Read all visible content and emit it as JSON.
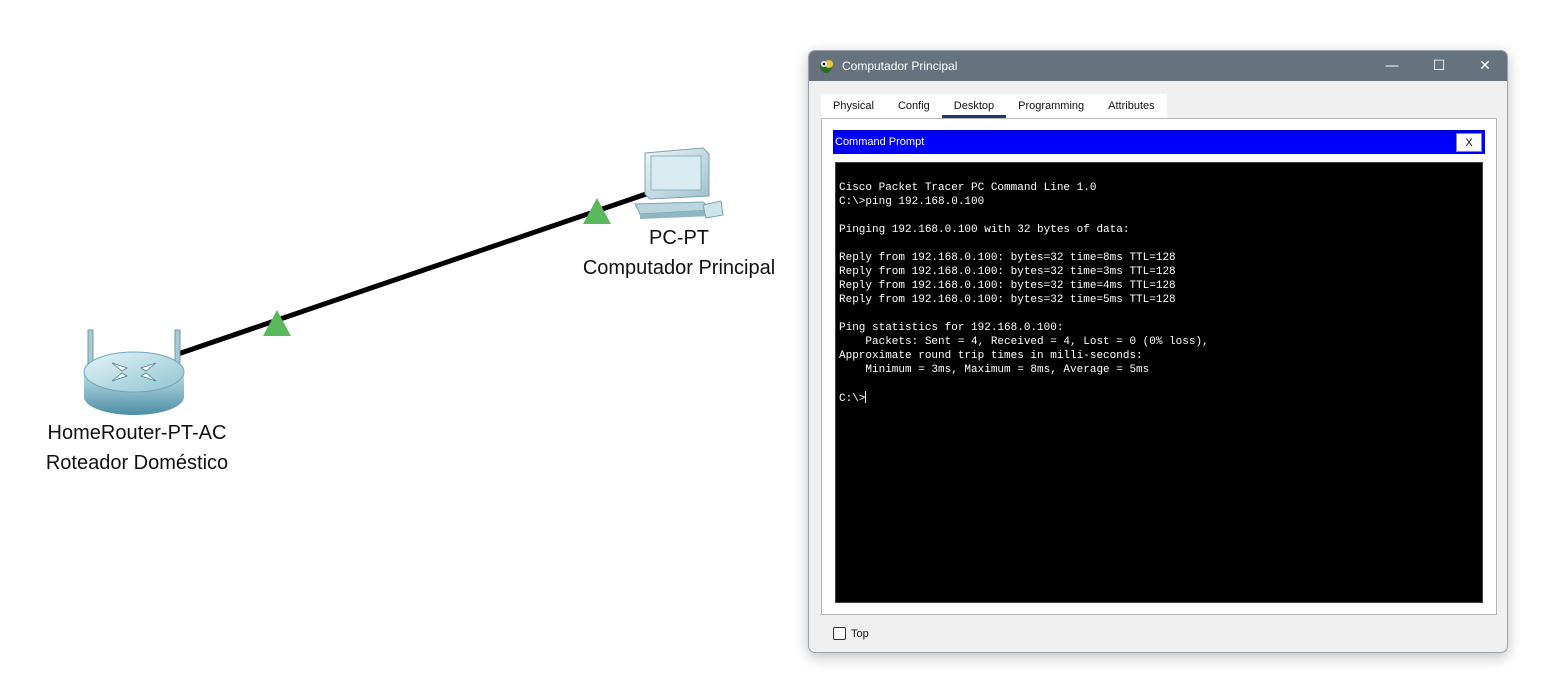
{
  "topology": {
    "router": {
      "model": "HomeRouter-PT-AC",
      "name": "Roteador Doméstico"
    },
    "pc": {
      "model": "PC-PT",
      "name": "Computador Principal"
    },
    "link_color": "#000000",
    "link_status_color": "#5cb85c"
  },
  "window": {
    "title": "Computador Principal",
    "minimize": "—",
    "maximize": "☐",
    "close": "✕",
    "tabs": [
      {
        "label": "Physical",
        "active": false
      },
      {
        "label": "Config",
        "active": false
      },
      {
        "label": "Desktop",
        "active": true
      },
      {
        "label": "Programming",
        "active": false
      },
      {
        "label": "Attributes",
        "active": false
      }
    ],
    "command_prompt": {
      "title": "Command Prompt",
      "close_label": "X",
      "lines": [
        "Cisco Packet Tracer PC Command Line 1.0",
        "C:\\>ping 192.168.0.100",
        "",
        "Pinging 192.168.0.100 with 32 bytes of data:",
        "",
        "Reply from 192.168.0.100: bytes=32 time=8ms TTL=128",
        "Reply from 192.168.0.100: bytes=32 time=3ms TTL=128",
        "Reply from 192.168.0.100: bytes=32 time=4ms TTL=128",
        "Reply from 192.168.0.100: bytes=32 time=5ms TTL=128",
        "",
        "Ping statistics for 192.168.0.100:",
        "    Packets: Sent = 4, Received = 4, Lost = 0 (0% loss),",
        "Approximate round trip times in milli-seconds:",
        "    Minimum = 3ms, Maximum = 8ms, Average = 5ms",
        "",
        "C:\\>"
      ]
    },
    "top_checkbox": {
      "label": "Top",
      "checked": false
    }
  },
  "colors": {
    "titlebar": "#66737f",
    "cmd_header": "#0000ff",
    "active_tab": "#1d3b6a",
    "terminal_bg": "#000000",
    "terminal_fg": "#ffffff"
  }
}
